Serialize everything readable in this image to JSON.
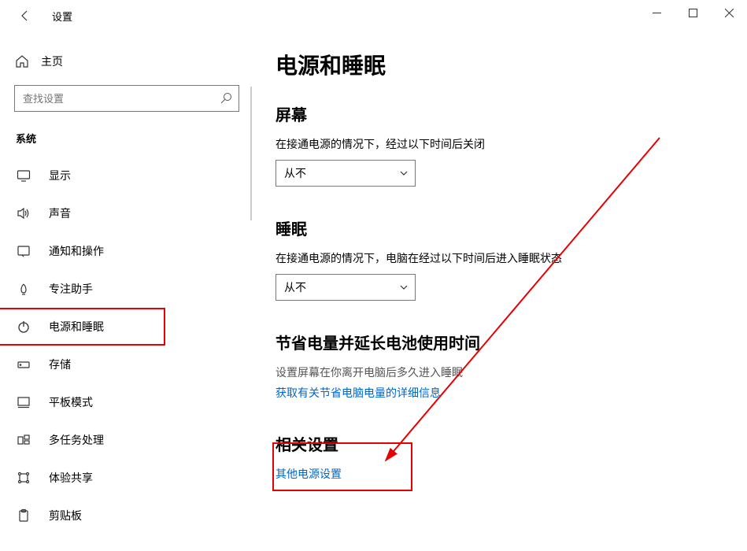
{
  "titlebar": {
    "title": "设置"
  },
  "sidebar": {
    "home": "主页",
    "search_placeholder": "查找设置",
    "group": "系统",
    "items": [
      {
        "label": "显示"
      },
      {
        "label": "声音"
      },
      {
        "label": "通知和操作"
      },
      {
        "label": "专注助手"
      },
      {
        "label": "电源和睡眠"
      },
      {
        "label": "存储"
      },
      {
        "label": "平板模式"
      },
      {
        "label": "多任务处理"
      },
      {
        "label": "体验共享"
      },
      {
        "label": "剪贴板"
      }
    ]
  },
  "main": {
    "heading": "电源和睡眠",
    "screen": {
      "title": "屏幕",
      "desc": "在接通电源的情况下，经过以下时间后关闭",
      "value": "从不"
    },
    "sleep": {
      "title": "睡眠",
      "desc": "在接通电源的情况下，电脑在经过以下时间后进入睡眠状态",
      "value": "从不"
    },
    "battery": {
      "title": "节省电量并延长电池使用时间",
      "desc": "设置屏幕在你离开电脑后多久进入睡眠",
      "link": "获取有关节省电脑电量的详细信息"
    },
    "related": {
      "title": "相关设置",
      "link": "其他电源设置"
    }
  }
}
